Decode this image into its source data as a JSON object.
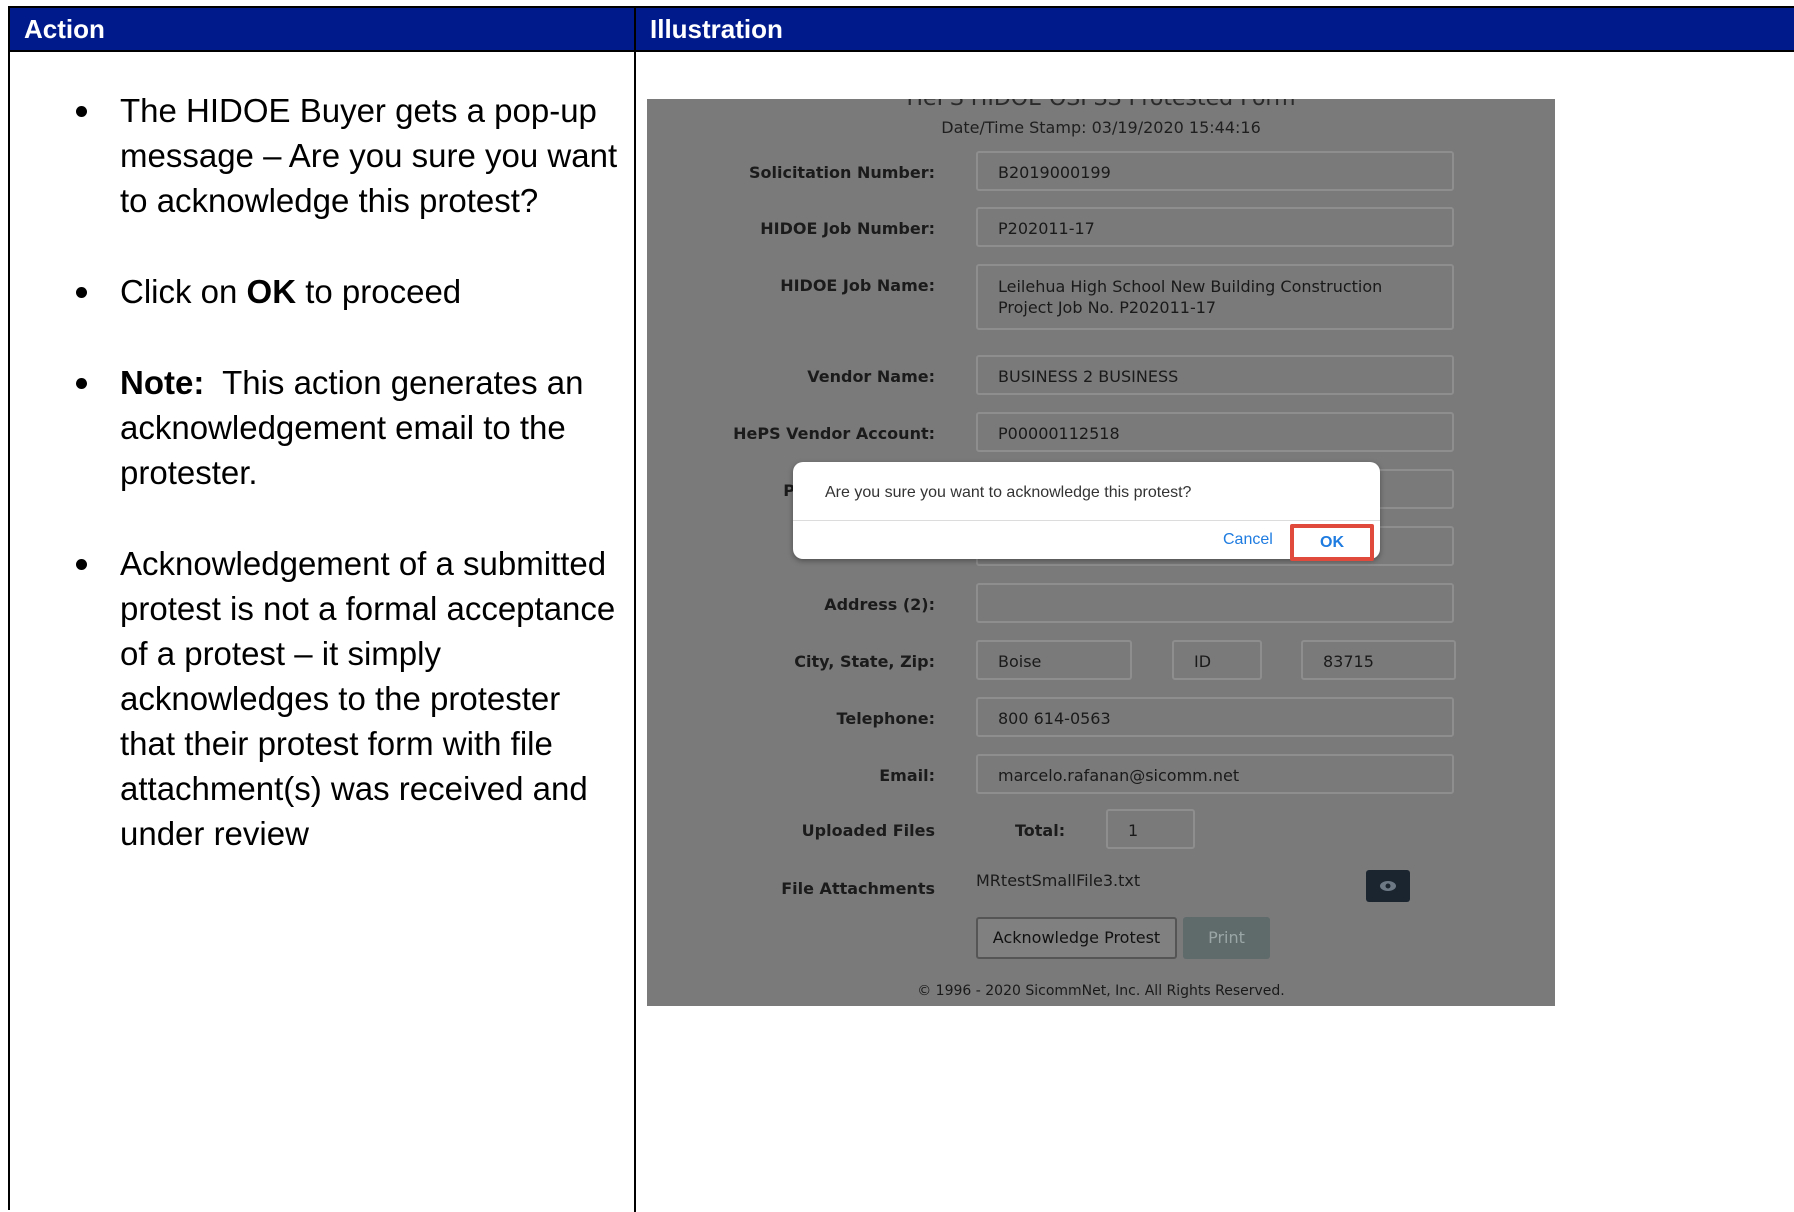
{
  "table": {
    "header_action": "Action",
    "header_illustration": "Illustration"
  },
  "action": {
    "bullet1": "The HIDOE Buyer gets a pop-up message – Are you sure you want to acknowledge this protest?",
    "bullet2_pre": "Click on ",
    "bullet2_bold": "OK",
    "bullet2_post": " to proceed",
    "bullet3_bold": "Note:",
    "bullet3_text": "  This action generates an acknowledgement email to the protester.",
    "bullet4": "Acknowledgement of a submitted protest is not a formal acceptance of a protest – it simply acknowledges to the protester that their protest form with file attachment(s) was received and under review"
  },
  "form": {
    "title": "HePS HIDOE OSPSS Protested Form",
    "stamp": "Date/Time Stamp: 03/19/2020 15:44:16",
    "labels": {
      "solicitation": "Solicitation Number:",
      "job_number": "HIDOE Job Number:",
      "job_name": "HIDOE Job Name:",
      "vendor_name": "Vendor Name:",
      "vendor_account": "HePS Vendor Account:",
      "partial_p": "P",
      "address2": "Address (2):",
      "city_state_zip": "City, State, Zip:",
      "telephone": "Telephone:",
      "email": "Email:",
      "uploaded_files": "Uploaded Files",
      "total": "Total:",
      "file_attachments": "File Attachments"
    },
    "values": {
      "solicitation": "B2019000199",
      "job_number": "P202011-17",
      "job_name": "Leilehua High School New Building Construction Project Job No. P202011-17",
      "vendor_name": "BUSINESS 2 BUSINESS",
      "vendor_account": "P00000112518",
      "address2": "",
      "city": "Boise",
      "state": "ID",
      "zip": "83715",
      "telephone": "800 614-0563",
      "email": "marcelo.rafanan@sicomm.net",
      "total": "1",
      "file_name": "MRtestSmallFile3.txt"
    },
    "buttons": {
      "acknowledge": "Acknowledge Protest",
      "print": "Print"
    },
    "copyright": "© 1996 - 2020 SicommNet, Inc. All Rights Reserved."
  },
  "dialog": {
    "message": "Are you sure you want to acknowledge this protest?",
    "cancel": "Cancel",
    "ok": "OK"
  },
  "colors": {
    "header_bg": "#001a8c",
    "overlay_gray": "#7a7a7a",
    "highlight_red": "#e04a3c",
    "link_blue": "#1e7be0"
  }
}
